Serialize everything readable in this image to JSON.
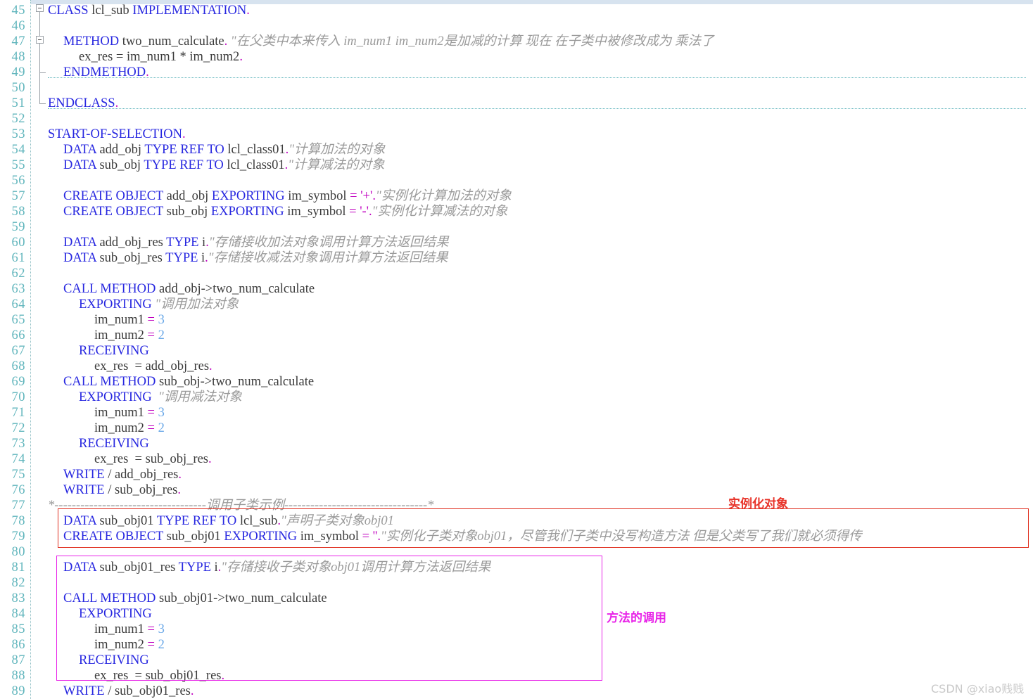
{
  "editor": {
    "language": "ABAP",
    "first_line_number": 45,
    "line_height": 22,
    "colors": {
      "keyword": "#2727e0",
      "identifier": "#3b3b3b",
      "comment": "#9a9a9a",
      "string": "#c000c0",
      "number": "#6aa8e8",
      "line_number": "#62b6bd",
      "annotation_red": "#e8342a",
      "annotation_magenta": "#e824e8",
      "background": "#ffffff"
    }
  },
  "lines": [
    {
      "n": "45",
      "indent": 0,
      "tokens": [
        {
          "t": "kw",
          "v": "CLASS"
        },
        {
          "t": "id",
          "v": " lcl_sub "
        },
        {
          "t": "kw",
          "v": "IMPLEMENTATION"
        },
        {
          "t": "op",
          "v": "."
        }
      ]
    },
    {
      "n": "46",
      "indent": 0,
      "tokens": []
    },
    {
      "n": "47",
      "indent": 1,
      "tokens": [
        {
          "t": "kw",
          "v": "METHOD"
        },
        {
          "t": "id",
          "v": " two_num_calculate"
        },
        {
          "t": "op",
          "v": "."
        },
        {
          "t": "cmt",
          "v": " \"在父类中本来传入 im_num1 im_num2是加减的计算 现在 在子类中被修改成为 乘法了"
        }
      ]
    },
    {
      "n": "48",
      "indent": 2,
      "tokens": [
        {
          "t": "id",
          "v": "ex_res = im_num1 "
        },
        {
          "t": "id",
          "v": "* im_num2"
        },
        {
          "t": "op",
          "v": "."
        }
      ]
    },
    {
      "n": "49",
      "indent": 1,
      "tokens": [
        {
          "t": "kw",
          "v": "ENDMETHOD"
        },
        {
          "t": "op",
          "v": "."
        }
      ]
    },
    {
      "n": "50",
      "indent": 0,
      "tokens": []
    },
    {
      "n": "51",
      "indent": 0,
      "tokens": [
        {
          "t": "kw",
          "v": "ENDCLASS"
        },
        {
          "t": "op",
          "v": "."
        }
      ]
    },
    {
      "n": "52",
      "indent": 0,
      "tokens": []
    },
    {
      "n": "53",
      "indent": 0,
      "tokens": [
        {
          "t": "kw",
          "v": "START-OF-SELECTION"
        },
        {
          "t": "op",
          "v": "."
        }
      ]
    },
    {
      "n": "54",
      "indent": 1,
      "tokens": [
        {
          "t": "kw",
          "v": "DATA"
        },
        {
          "t": "id",
          "v": " add_obj "
        },
        {
          "t": "kw",
          "v": "TYPE REF TO"
        },
        {
          "t": "id",
          "v": " lcl_class01"
        },
        {
          "t": "op",
          "v": "."
        },
        {
          "t": "cmt",
          "v": "\"计算加法的对象"
        }
      ]
    },
    {
      "n": "55",
      "indent": 1,
      "tokens": [
        {
          "t": "kw",
          "v": "DATA"
        },
        {
          "t": "id",
          "v": " sub_obj "
        },
        {
          "t": "kw",
          "v": "TYPE REF TO"
        },
        {
          "t": "id",
          "v": " lcl_class01"
        },
        {
          "t": "op",
          "v": "."
        },
        {
          "t": "cmt",
          "v": "\"计算减法的对象"
        }
      ]
    },
    {
      "n": "56",
      "indent": 0,
      "tokens": []
    },
    {
      "n": "57",
      "indent": 1,
      "tokens": [
        {
          "t": "kw",
          "v": "CREATE OBJECT"
        },
        {
          "t": "id",
          "v": " add_obj "
        },
        {
          "t": "kw",
          "v": "EXPORTING"
        },
        {
          "t": "id",
          "v": " im_symbol "
        },
        {
          "t": "op",
          "v": "= "
        },
        {
          "t": "str",
          "v": "'+'"
        },
        {
          "t": "op",
          "v": "."
        },
        {
          "t": "cmt",
          "v": "\"实例化计算加法的对象"
        }
      ]
    },
    {
      "n": "58",
      "indent": 1,
      "tokens": [
        {
          "t": "kw",
          "v": "CREATE OBJECT"
        },
        {
          "t": "id",
          "v": " sub_obj "
        },
        {
          "t": "kw",
          "v": "EXPORTING"
        },
        {
          "t": "id",
          "v": " im_symbol "
        },
        {
          "t": "op",
          "v": "= "
        },
        {
          "t": "str",
          "v": "'-'"
        },
        {
          "t": "op",
          "v": "."
        },
        {
          "t": "cmt",
          "v": "\"实例化计算减法的对象"
        }
      ]
    },
    {
      "n": "59",
      "indent": 0,
      "tokens": []
    },
    {
      "n": "60",
      "indent": 1,
      "tokens": [
        {
          "t": "kw",
          "v": "DATA"
        },
        {
          "t": "id",
          "v": " add_obj_res "
        },
        {
          "t": "kw",
          "v": "TYPE"
        },
        {
          "t": "id",
          "v": " i"
        },
        {
          "t": "op",
          "v": "."
        },
        {
          "t": "cmt",
          "v": "\"存储接收加法对象调用计算方法返回结果"
        }
      ]
    },
    {
      "n": "61",
      "indent": 1,
      "tokens": [
        {
          "t": "kw",
          "v": "DATA"
        },
        {
          "t": "id",
          "v": " sub_obj_res "
        },
        {
          "t": "kw",
          "v": "TYPE"
        },
        {
          "t": "id",
          "v": " i"
        },
        {
          "t": "op",
          "v": "."
        },
        {
          "t": "cmt",
          "v": "\"存储接收减法对象调用计算方法返回结果"
        }
      ]
    },
    {
      "n": "62",
      "indent": 0,
      "tokens": []
    },
    {
      "n": "63",
      "indent": 1,
      "tokens": [
        {
          "t": "kw",
          "v": "CALL METHOD"
        },
        {
          "t": "id",
          "v": " add_obj->two_num_calculate"
        }
      ]
    },
    {
      "n": "64",
      "indent": 2,
      "tokens": [
        {
          "t": "kw",
          "v": "EXPORTING"
        },
        {
          "t": "cmt",
          "v": " \"调用加法对象"
        }
      ]
    },
    {
      "n": "65",
      "indent": 3,
      "tokens": [
        {
          "t": "id",
          "v": "im_num1 "
        },
        {
          "t": "op",
          "v": "= "
        },
        {
          "t": "num",
          "v": "3"
        }
      ]
    },
    {
      "n": "66",
      "indent": 3,
      "tokens": [
        {
          "t": "id",
          "v": "im_num2 "
        },
        {
          "t": "op",
          "v": "= "
        },
        {
          "t": "num",
          "v": "2"
        }
      ]
    },
    {
      "n": "67",
      "indent": 2,
      "tokens": [
        {
          "t": "kw",
          "v": "RECEIVING"
        }
      ]
    },
    {
      "n": "68",
      "indent": 3,
      "tokens": [
        {
          "t": "id",
          "v": "ex_res  = add_obj_res"
        },
        {
          "t": "op",
          "v": "."
        }
      ]
    },
    {
      "n": "69",
      "indent": 1,
      "tokens": [
        {
          "t": "kw",
          "v": "CALL METHOD"
        },
        {
          "t": "id",
          "v": " sub_obj->two_num_calculate"
        }
      ]
    },
    {
      "n": "70",
      "indent": 2,
      "tokens": [
        {
          "t": "kw",
          "v": "EXPORTING"
        },
        {
          "t": "cmt",
          "v": "  \"调用减法对象"
        }
      ]
    },
    {
      "n": "71",
      "indent": 3,
      "tokens": [
        {
          "t": "id",
          "v": "im_num1 "
        },
        {
          "t": "op",
          "v": "= "
        },
        {
          "t": "num",
          "v": "3"
        }
      ]
    },
    {
      "n": "72",
      "indent": 3,
      "tokens": [
        {
          "t": "id",
          "v": "im_num2 "
        },
        {
          "t": "op",
          "v": "= "
        },
        {
          "t": "num",
          "v": "2"
        }
      ]
    },
    {
      "n": "73",
      "indent": 2,
      "tokens": [
        {
          "t": "kw",
          "v": "RECEIVING"
        }
      ]
    },
    {
      "n": "74",
      "indent": 3,
      "tokens": [
        {
          "t": "id",
          "v": "ex_res  = sub_obj_res"
        },
        {
          "t": "op",
          "v": "."
        }
      ]
    },
    {
      "n": "75",
      "indent": 1,
      "tokens": [
        {
          "t": "kw",
          "v": "WRITE"
        },
        {
          "t": "id",
          "v": " / add_obj_res"
        },
        {
          "t": "op",
          "v": "."
        }
      ]
    },
    {
      "n": "76",
      "indent": 1,
      "tokens": [
        {
          "t": "kw",
          "v": "WRITE"
        },
        {
          "t": "id",
          "v": " / sub_obj_res"
        },
        {
          "t": "op",
          "v": "."
        }
      ]
    },
    {
      "n": "77",
      "indent": 0,
      "tokens": [
        {
          "t": "cmt",
          "v": "*-----------------------------------调用子类示例---------------------------------*"
        }
      ]
    },
    {
      "n": "78",
      "indent": 1,
      "tokens": [
        {
          "t": "kw",
          "v": "DATA"
        },
        {
          "t": "id",
          "v": " sub_obj01 "
        },
        {
          "t": "kw",
          "v": "TYPE REF TO"
        },
        {
          "t": "id",
          "v": " lcl_sub"
        },
        {
          "t": "op",
          "v": "."
        },
        {
          "t": "cmt",
          "v": "\"声明子类对象obj01"
        }
      ]
    },
    {
      "n": "79",
      "indent": 1,
      "tokens": [
        {
          "t": "kw",
          "v": "CREATE OBJECT"
        },
        {
          "t": "id",
          "v": " sub_obj01 "
        },
        {
          "t": "kw",
          "v": "EXPORTING"
        },
        {
          "t": "id",
          "v": " im_symbol "
        },
        {
          "t": "op",
          "v": "= "
        },
        {
          "t": "str",
          "v": "''"
        },
        {
          "t": "op",
          "v": "."
        },
        {
          "t": "cmt",
          "v": "\"实例化子类对象obj01，尽管我们子类中没写构造方法 但是父类写了我们就必须得传"
        }
      ]
    },
    {
      "n": "80",
      "indent": 0,
      "tokens": []
    },
    {
      "n": "81",
      "indent": 1,
      "tokens": [
        {
          "t": "kw",
          "v": "DATA"
        },
        {
          "t": "id",
          "v": " sub_obj01_res "
        },
        {
          "t": "kw",
          "v": "TYPE"
        },
        {
          "t": "id",
          "v": " i"
        },
        {
          "t": "op",
          "v": "."
        },
        {
          "t": "cmt",
          "v": "\"存储接收子类对象obj01调用计算方法返回结果"
        }
      ]
    },
    {
      "n": "82",
      "indent": 0,
      "tokens": []
    },
    {
      "n": "83",
      "indent": 1,
      "tokens": [
        {
          "t": "kw",
          "v": "CALL METHOD"
        },
        {
          "t": "id",
          "v": " sub_obj01->two_num_calculate"
        }
      ]
    },
    {
      "n": "84",
      "indent": 2,
      "tokens": [
        {
          "t": "kw",
          "v": "EXPORTING"
        }
      ]
    },
    {
      "n": "85",
      "indent": 3,
      "tokens": [
        {
          "t": "id",
          "v": "im_num1 "
        },
        {
          "t": "op",
          "v": "= "
        },
        {
          "t": "num",
          "v": "3"
        }
      ]
    },
    {
      "n": "86",
      "indent": 3,
      "tokens": [
        {
          "t": "id",
          "v": "im_num2 "
        },
        {
          "t": "op",
          "v": "= "
        },
        {
          "t": "num",
          "v": "2"
        }
      ]
    },
    {
      "n": "87",
      "indent": 2,
      "tokens": [
        {
          "t": "kw",
          "v": "RECEIVING"
        }
      ]
    },
    {
      "n": "88",
      "indent": 3,
      "tokens": [
        {
          "t": "id",
          "v": "ex_res  = sub_obj01_res"
        },
        {
          "t": "op",
          "v": "."
        }
      ]
    },
    {
      "n": "89",
      "indent": 1,
      "tokens": [
        {
          "t": "kw",
          "v": "WRITE"
        },
        {
          "t": "id",
          "v": " / sub_obj01_res"
        },
        {
          "t": "op",
          "v": "."
        }
      ]
    }
  ],
  "annotations": {
    "red_label": "实例化对象",
    "magenta_label": "方法的调用"
  },
  "watermark": {
    "text": "CSDN @xiao贱贱"
  }
}
